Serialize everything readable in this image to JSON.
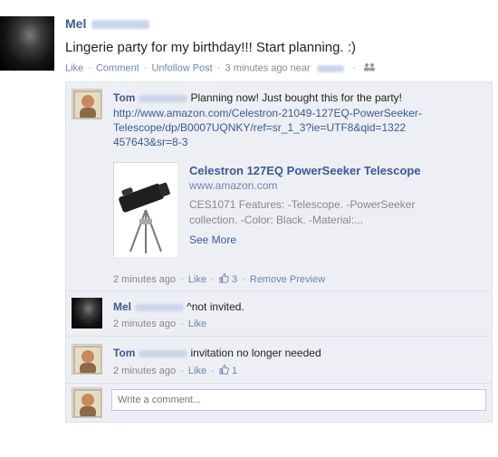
{
  "post": {
    "author": "Mel",
    "text": "Lingerie party for my birthday!!! Start planning. :)",
    "actions": {
      "like": "Like",
      "comment": "Comment",
      "unfollow": "Unfollow Post",
      "time": "3 minutes ago near",
      "sep": "·"
    },
    "icon": "people-icon"
  },
  "comments": [
    {
      "author": "Tom",
      "text": "Planning now! Just bought this for the party!",
      "url": "http://www.amazon.com/Celestron-21049-127EQ-PowerSeeker-Telescope/dp/B0007UQNKY/ref=sr_1_3?ie=UTF8&qid=1322457643&sr=8-3",
      "url_lines": [
        "http://www.amazon.com/Celestron-21049-127EQ-PowerSeeker-",
        "Telescope/dp/B0007UQNKY/ref=sr_1_3?ie=UTF8&qid=1322",
        "457643&sr=8-3"
      ],
      "preview": {
        "title": "Celestron 127EQ PowerSeeker Telescope",
        "domain": "www.amazon.com",
        "desc_lines": [
          "CES1071 Features: -Telescope. -PowerSeeker",
          "collection. -Color: Black. -Material:..."
        ],
        "more": "See More"
      },
      "meta": {
        "time": "2 minutes ago",
        "like": "Like",
        "likes": "3",
        "remove": "Remove Preview"
      }
    },
    {
      "author": "Mel",
      "text": "^not invited.",
      "meta": {
        "time": "2 minutes ago",
        "like": "Like"
      }
    },
    {
      "author": "Tom",
      "text": "invitation no longer needed",
      "meta": {
        "time": "2 minutes ago",
        "like": "Like",
        "likes": "1"
      }
    }
  ],
  "write_comment": {
    "placeholder": "Write a comment..."
  },
  "colors": {
    "link": "#3b5998",
    "meta": "#888888",
    "panel": "#edeff4"
  }
}
